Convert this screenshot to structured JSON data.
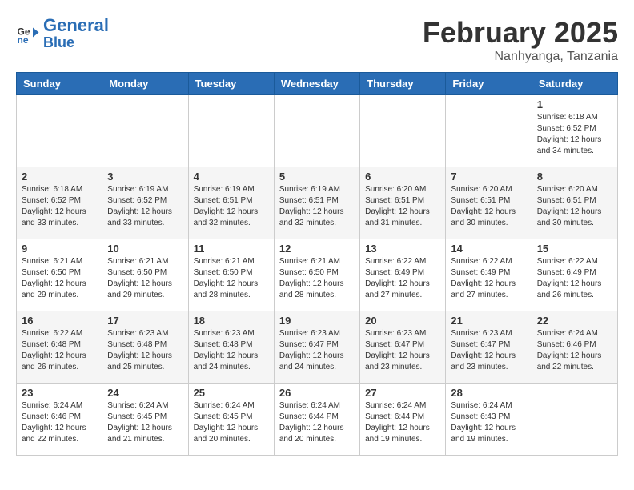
{
  "logo": {
    "line1": "General",
    "line2": "Blue"
  },
  "title": "February 2025",
  "location": "Nanhyanga, Tanzania",
  "weekdays": [
    "Sunday",
    "Monday",
    "Tuesday",
    "Wednesday",
    "Thursday",
    "Friday",
    "Saturday"
  ],
  "weeks": [
    [
      {
        "day": "",
        "info": ""
      },
      {
        "day": "",
        "info": ""
      },
      {
        "day": "",
        "info": ""
      },
      {
        "day": "",
        "info": ""
      },
      {
        "day": "",
        "info": ""
      },
      {
        "day": "",
        "info": ""
      },
      {
        "day": "1",
        "info": "Sunrise: 6:18 AM\nSunset: 6:52 PM\nDaylight: 12 hours and 34 minutes."
      }
    ],
    [
      {
        "day": "2",
        "info": "Sunrise: 6:18 AM\nSunset: 6:52 PM\nDaylight: 12 hours and 33 minutes."
      },
      {
        "day": "3",
        "info": "Sunrise: 6:19 AM\nSunset: 6:52 PM\nDaylight: 12 hours and 33 minutes."
      },
      {
        "day": "4",
        "info": "Sunrise: 6:19 AM\nSunset: 6:51 PM\nDaylight: 12 hours and 32 minutes."
      },
      {
        "day": "5",
        "info": "Sunrise: 6:19 AM\nSunset: 6:51 PM\nDaylight: 12 hours and 32 minutes."
      },
      {
        "day": "6",
        "info": "Sunrise: 6:20 AM\nSunset: 6:51 PM\nDaylight: 12 hours and 31 minutes."
      },
      {
        "day": "7",
        "info": "Sunrise: 6:20 AM\nSunset: 6:51 PM\nDaylight: 12 hours and 30 minutes."
      },
      {
        "day": "8",
        "info": "Sunrise: 6:20 AM\nSunset: 6:51 PM\nDaylight: 12 hours and 30 minutes."
      }
    ],
    [
      {
        "day": "9",
        "info": "Sunrise: 6:21 AM\nSunset: 6:50 PM\nDaylight: 12 hours and 29 minutes."
      },
      {
        "day": "10",
        "info": "Sunrise: 6:21 AM\nSunset: 6:50 PM\nDaylight: 12 hours and 29 minutes."
      },
      {
        "day": "11",
        "info": "Sunrise: 6:21 AM\nSunset: 6:50 PM\nDaylight: 12 hours and 28 minutes."
      },
      {
        "day": "12",
        "info": "Sunrise: 6:21 AM\nSunset: 6:50 PM\nDaylight: 12 hours and 28 minutes."
      },
      {
        "day": "13",
        "info": "Sunrise: 6:22 AM\nSunset: 6:49 PM\nDaylight: 12 hours and 27 minutes."
      },
      {
        "day": "14",
        "info": "Sunrise: 6:22 AM\nSunset: 6:49 PM\nDaylight: 12 hours and 27 minutes."
      },
      {
        "day": "15",
        "info": "Sunrise: 6:22 AM\nSunset: 6:49 PM\nDaylight: 12 hours and 26 minutes."
      }
    ],
    [
      {
        "day": "16",
        "info": "Sunrise: 6:22 AM\nSunset: 6:48 PM\nDaylight: 12 hours and 26 minutes."
      },
      {
        "day": "17",
        "info": "Sunrise: 6:23 AM\nSunset: 6:48 PM\nDaylight: 12 hours and 25 minutes."
      },
      {
        "day": "18",
        "info": "Sunrise: 6:23 AM\nSunset: 6:48 PM\nDaylight: 12 hours and 24 minutes."
      },
      {
        "day": "19",
        "info": "Sunrise: 6:23 AM\nSunset: 6:47 PM\nDaylight: 12 hours and 24 minutes."
      },
      {
        "day": "20",
        "info": "Sunrise: 6:23 AM\nSunset: 6:47 PM\nDaylight: 12 hours and 23 minutes."
      },
      {
        "day": "21",
        "info": "Sunrise: 6:23 AM\nSunset: 6:47 PM\nDaylight: 12 hours and 23 minutes."
      },
      {
        "day": "22",
        "info": "Sunrise: 6:24 AM\nSunset: 6:46 PM\nDaylight: 12 hours and 22 minutes."
      }
    ],
    [
      {
        "day": "23",
        "info": "Sunrise: 6:24 AM\nSunset: 6:46 PM\nDaylight: 12 hours and 22 minutes."
      },
      {
        "day": "24",
        "info": "Sunrise: 6:24 AM\nSunset: 6:45 PM\nDaylight: 12 hours and 21 minutes."
      },
      {
        "day": "25",
        "info": "Sunrise: 6:24 AM\nSunset: 6:45 PM\nDaylight: 12 hours and 20 minutes."
      },
      {
        "day": "26",
        "info": "Sunrise: 6:24 AM\nSunset: 6:44 PM\nDaylight: 12 hours and 20 minutes."
      },
      {
        "day": "27",
        "info": "Sunrise: 6:24 AM\nSunset: 6:44 PM\nDaylight: 12 hours and 19 minutes."
      },
      {
        "day": "28",
        "info": "Sunrise: 6:24 AM\nSunset: 6:43 PM\nDaylight: 12 hours and 19 minutes."
      },
      {
        "day": "",
        "info": ""
      }
    ]
  ]
}
